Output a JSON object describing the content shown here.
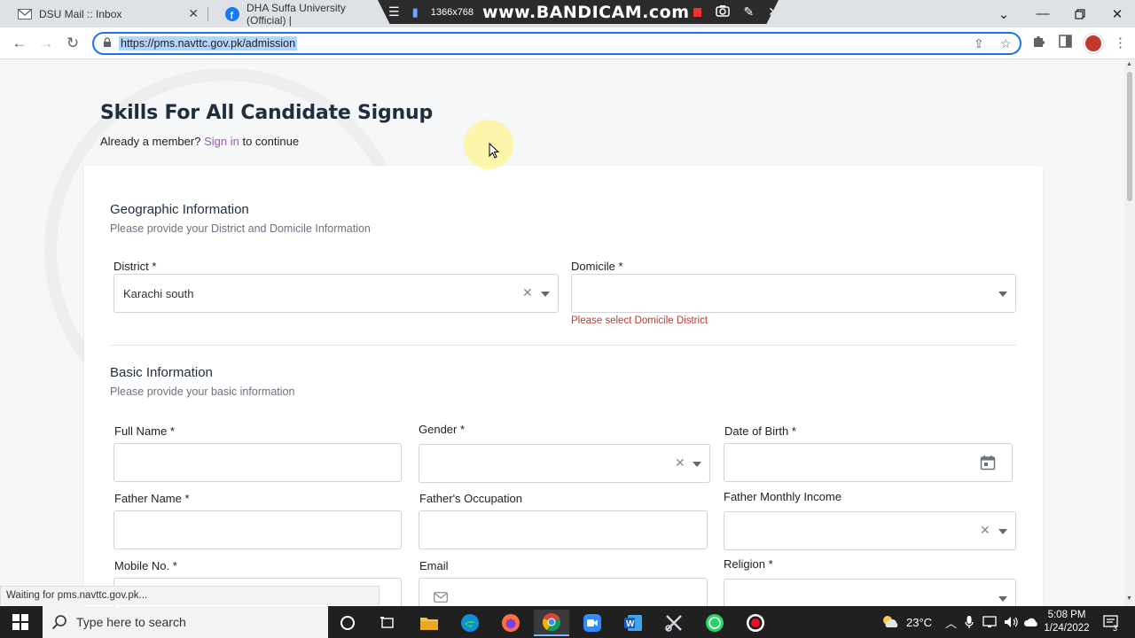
{
  "browser": {
    "tabs": [
      {
        "title": "DSU Mail :: Inbox",
        "favicon": "gmail-icon"
      },
      {
        "title": "DHA Suffa University (Official) |",
        "favicon": "facebook-icon"
      }
    ],
    "url": "https://pms.navttc.gov.pk/admission",
    "status_text": "Waiting for pms.navttc.gov.pk..."
  },
  "recorder": {
    "resolution": "1366x768",
    "logo": "www.BANDICAM.com"
  },
  "page": {
    "title": "Skills For All Candidate Signup",
    "member_prefix": "Already a member?",
    "signin_link": "Sign in",
    "member_suffix": "to continue"
  },
  "geo": {
    "title": "Geographic Information",
    "subtitle": "Please provide your District and Domicile Information",
    "district_label": "District *",
    "district_value": "Karachi south",
    "domicile_label": "Domicile *",
    "domicile_value": "",
    "domicile_error": "Please select Domicile District"
  },
  "basic": {
    "title": "Basic Information",
    "subtitle": "Please provide your basic information",
    "full_name_label": "Full Name *",
    "gender_label": "Gender *",
    "dob_label": "Date of Birth *",
    "father_name_label": "Father Name *",
    "father_occupation_label": "Father's Occupation",
    "father_income_label": "Father Monthly Income",
    "mobile_label": "Mobile No. *",
    "email_label": "Email",
    "religion_label": "Religion *"
  },
  "taskbar": {
    "search_placeholder": "Type here to search",
    "weather": "23°C",
    "time": "5:08 PM",
    "date": "1/24/2022",
    "notifications": "3"
  },
  "colors": {
    "accent": "#1a73e8",
    "link": "#9b59b6",
    "error": "#c0392b",
    "title": "#1f2d3d"
  }
}
